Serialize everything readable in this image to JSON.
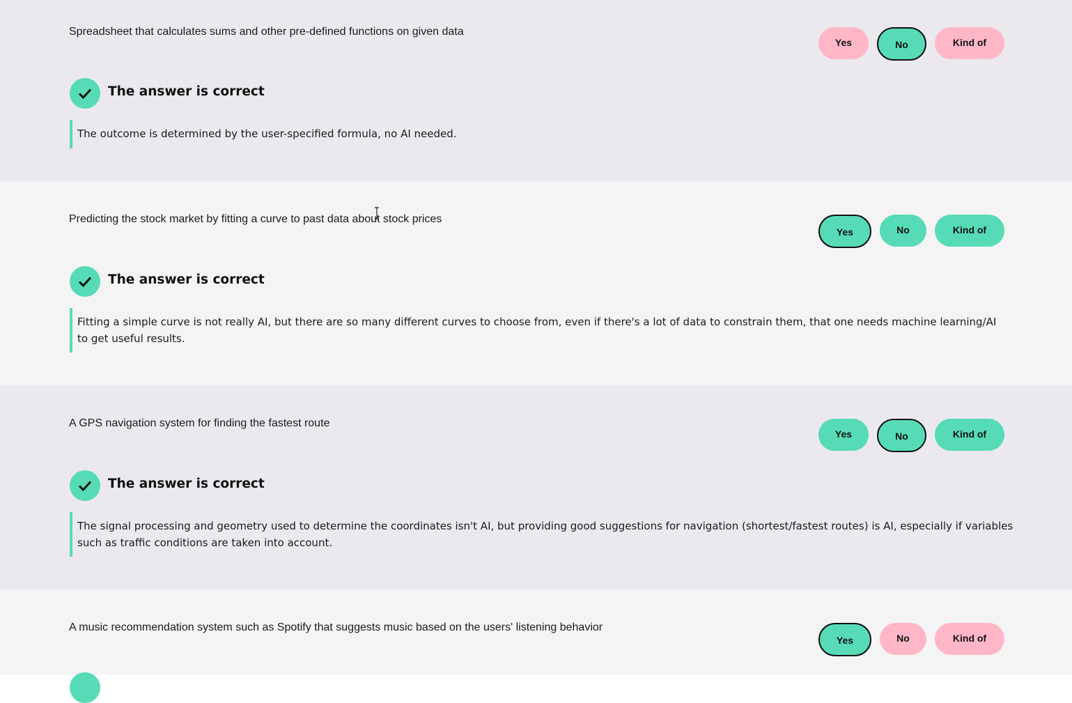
{
  "labels": {
    "yes": "Yes",
    "no": "No",
    "kind_of": "Kind of"
  },
  "colors": {
    "accent_green": "#57dbb7",
    "incorrect_pink": "#ffb7c8",
    "row_bg_a": "#ebe9ee",
    "row_bg_b": "#f5f4f4"
  },
  "questions": [
    {
      "text": "Spreadsheet that calculates sums and other pre-defined functions on given data",
      "selected": "No",
      "result": "The answer is correct",
      "explanation": "The outcome is determined by the user-specified formula, no AI needed."
    },
    {
      "text": "Predicting the stock market by fitting a curve to past data about stock prices",
      "selected": "Yes",
      "result": "The answer is correct",
      "explanation": "Fitting a simple curve is not really AI, but there are so many different curves to choose from, even if there's a lot of data to constrain them, that one needs machine learning/AI to get useful results."
    },
    {
      "text": "A GPS navigation system for finding the fastest route",
      "selected": "No",
      "result": "The answer is correct",
      "explanation": "The signal processing and geometry used to determine the coordinates isn't AI, but providing good suggestions for navigation (shortest/fastest routes) is AI, especially if variables such as traffic conditions are taken into account."
    },
    {
      "text": "A music recommendation system such as Spotify that suggests music based on the users' listening behavior",
      "selected": "Yes"
    }
  ]
}
